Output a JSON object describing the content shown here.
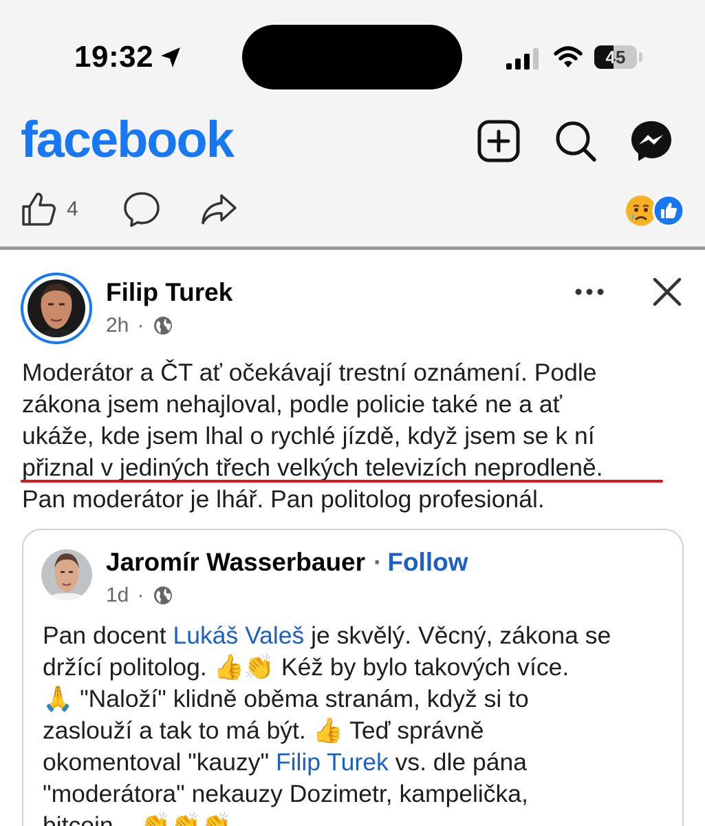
{
  "status_bar": {
    "time": "19:32",
    "battery_percent": "45",
    "battery_level": 0.45
  },
  "header": {
    "logo_text": "facebook",
    "brand_color": "#1877f2",
    "icons": [
      "plus-square-icon",
      "search-icon",
      "messenger-icon"
    ]
  },
  "reactions_bar": {
    "like_count": "4",
    "reaction_emojis": [
      "crying-face-icon",
      "like-icon"
    ]
  },
  "post": {
    "author": "Filip Turek",
    "time_ago": "2h",
    "separator": "·",
    "text_lines": [
      "Moderátor a ČT ať očekávají trestní oznámení. Podle",
      "zákona jsem nehajloval, podle policie také ne a ať",
      "ukáže, kde jsem lhal o rychlé jízdě, když jsem se k ní",
      "přiznal v jediných třech velkých televizích neprodleně.",
      "Pan moderátor je lhář. Pan politolog profesionál."
    ]
  },
  "shared_post": {
    "author": "Jaromír Wasserbauer",
    "follow_separator": "·",
    "follow_label": "Follow",
    "time_ago": "1d",
    "separator": "·",
    "line1_pre": "Pan docent ",
    "line1_mention": "Lukáš Valeš",
    "line1_post": " je skvělý. Věcný, zákona se",
    "line2": "držící politolog. 👍👏 Kéž by bylo takových více.",
    "line3": "🙏 \"Naloží\" klidně oběma stranám, když si to",
    "line4": "zaslouží a tak to má být. 👍 Teď správně",
    "line5_pre": "okomentoval \"kauzy\" ",
    "line5_mention": "Filip Turek",
    "line5_post": " vs. dle pána",
    "line6": "\"moderátora\" nekauzy Dozimetr, kampelička,",
    "line7": "bitcoin... 👏👏👏"
  }
}
